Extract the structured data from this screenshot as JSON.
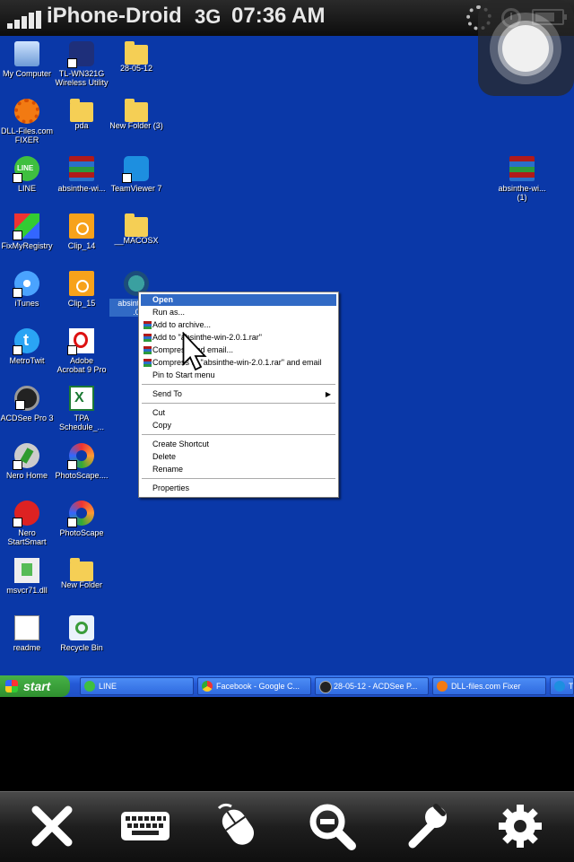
{
  "status_bar": {
    "carrier": "iPhone-Droid",
    "network": "3G",
    "time": "07:36 AM",
    "battery_level": 0.75
  },
  "desktop": {
    "icons": [
      {
        "label": "My Computer",
        "icon": "computer-icon"
      },
      {
        "label": "TL-WN321G\nWireless Utility",
        "icon": "wireless-utility-icon"
      },
      {
        "label": "28-05-12",
        "icon": "folder-icon"
      },
      {
        "label": "DLL-Files.com\nFIXER",
        "icon": "dll-fixer-icon"
      },
      {
        "label": "pda",
        "icon": "folder-icon"
      },
      {
        "label": "New Folder (3)",
        "icon": "folder-icon"
      },
      {
        "label": "LINE",
        "icon": "line-icon"
      },
      {
        "label": "absinthe-wi...",
        "icon": "rar-archive-icon"
      },
      {
        "label": "TeamViewer 7",
        "icon": "teamviewer-icon"
      },
      {
        "label": "absinthe-wi...\n(1)",
        "icon": "rar-archive-icon"
      },
      {
        "label": "FixMyRegistry",
        "icon": "fixmyregistry-icon"
      },
      {
        "label": "Clip_14",
        "icon": "jpg-image-icon"
      },
      {
        "label": "__MACOSX",
        "icon": "folder-icon"
      },
      {
        "label": "iTunes",
        "icon": "itunes-icon"
      },
      {
        "label": "Clip_15",
        "icon": "jpg-image-icon"
      },
      {
        "label": "absinthe...\n.0",
        "icon": "absinthe-app-icon"
      },
      {
        "label": "MetroTwit",
        "icon": "metrotwit-icon"
      },
      {
        "label": "Adobe\nAcrobat 9 Pro",
        "icon": "acrobat-icon"
      },
      {
        "label": "ACDSee Pro 3",
        "icon": "acdsee-icon"
      },
      {
        "label": "TPA\nSchedule_...",
        "icon": "excel-file-icon"
      },
      {
        "label": "Nero Home",
        "icon": "nero-home-icon"
      },
      {
        "label": "PhotoScape....",
        "icon": "photoscape-icon"
      },
      {
        "label": "Nero\nStartSmart",
        "icon": "nero-startsmart-icon"
      },
      {
        "label": "PhotoScape",
        "icon": "photoscape-icon"
      },
      {
        "label": "msvcr71.dll",
        "icon": "dll-file-icon"
      },
      {
        "label": "New Folder",
        "icon": "folder-icon"
      },
      {
        "label": "readme",
        "icon": "text-file-icon"
      },
      {
        "label": "Recycle Bin",
        "icon": "recycle-bin-icon"
      }
    ],
    "background_color": "#0a38a8"
  },
  "context_menu": {
    "items": [
      {
        "label": "Open",
        "selected": true
      },
      {
        "label": "Run as..."
      },
      {
        "label": "Add to archive...",
        "icon": "rar"
      },
      {
        "label": "Add to \"absinthe-win-2.0.1.rar\"",
        "icon": "rar"
      },
      {
        "label": "Compress and email...",
        "icon": "rar"
      },
      {
        "label": "Compress to \"absinthe-win-2.0.1.rar\" and email",
        "icon": "rar"
      },
      {
        "label": "Pin to Start menu"
      },
      {
        "label": "Send To",
        "submenu": true
      },
      {
        "label": "Cut"
      },
      {
        "label": "Copy"
      },
      {
        "label": "Create Shortcut"
      },
      {
        "label": "Delete"
      },
      {
        "label": "Rename"
      },
      {
        "label": "Properties"
      }
    ]
  },
  "taskbar": {
    "start_label": "start",
    "tasks": [
      {
        "label": "LINE",
        "icon": "line-icon"
      },
      {
        "label": "Facebook - Google C...",
        "icon": "chrome-icon"
      },
      {
        "label": "28-05-12 - ACDSee P...",
        "icon": "acdsee-icon"
      },
      {
        "label": "DLL-files.com Fixer",
        "icon": "dll-fixer-icon"
      },
      {
        "label": "T",
        "icon": "teamviewer-icon"
      }
    ]
  },
  "toolbar": {
    "buttons": [
      {
        "name": "close",
        "icon": "close-icon"
      },
      {
        "name": "keyboard",
        "icon": "keyboard-icon"
      },
      {
        "name": "mouse",
        "icon": "mouse-icon"
      },
      {
        "name": "zoom-out",
        "icon": "zoom-out-icon"
      },
      {
        "name": "settings-tools",
        "icon": "wrench-icon"
      },
      {
        "name": "settings",
        "icon": "gear-icon"
      }
    ]
  }
}
